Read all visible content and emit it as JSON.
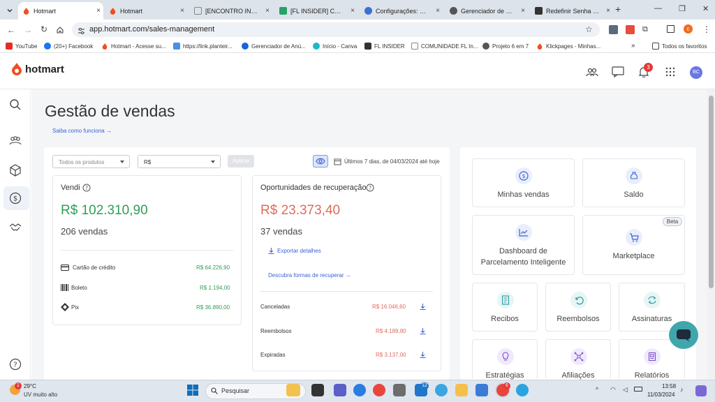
{
  "browser": {
    "tabs": [
      {
        "label": "Hotmart",
        "active": true
      },
      {
        "label": "Hotmart",
        "active": false
      },
      {
        "label": "[ENCONTRO INSIDER",
        "active": false
      },
      {
        "label": "[FL INSIDER] CENTRA",
        "active": false
      },
      {
        "label": "Configurações: Pree",
        "active": false
      },
      {
        "label": "Gerenciador de senh",
        "active": false
      },
      {
        "label": "Redefinir Senha ~ FL",
        "active": false
      }
    ],
    "new_tab_label": "+",
    "close_glyph": "×",
    "url": "app.hotmart.com/sales-management",
    "profile_initial": "c",
    "bookmarks": [
      {
        "label": "YouTube"
      },
      {
        "label": "(20+) Facebook"
      },
      {
        "label": "Hotmart - Acesse su..."
      },
      {
        "label": "https://link.planteir..."
      },
      {
        "label": "Gerenciador de Anú..."
      },
      {
        "label": "Início - Canva"
      },
      {
        "label": "FL INSIDER"
      },
      {
        "label": "COMUNIDADE FL In..."
      },
      {
        "label": "Projeto 6 em 7"
      },
      {
        "label": "Klickpages - Minhas..."
      }
    ],
    "bookmarks_overflow": "»",
    "all_bookmarks": "Todos os favoritos"
  },
  "app": {
    "brand": "hotmart",
    "notification_count": "3",
    "avatar_initials": "BC"
  },
  "page": {
    "title": "Gestão de vendas",
    "how_it_works": "Saiba como funciona →",
    "filters": {
      "products_placeholder": "Todos os produtos",
      "currency": "R$",
      "apply": "Aplicar",
      "date_range": "Últimos 7 dias, de 04/03/2024 até hoje"
    },
    "sold": {
      "title": "Vendi",
      "amount": "R$ 102.310,90",
      "count": "206 vendas",
      "methods": [
        {
          "label": "Cartão de crédito",
          "value": "R$ 64.226,90"
        },
        {
          "label": "Boleto",
          "value": "R$ 1.194,00"
        },
        {
          "label": "Pix",
          "value": "R$ 36.890,00"
        }
      ]
    },
    "recovery": {
      "title": "Oportunidades de recuperação",
      "amount": "R$ 23.373,40",
      "count": "37 vendas",
      "export": "Exportar detalhes",
      "discover": "Descubra formas de recuperar →",
      "items": [
        {
          "label": "Canceladas",
          "value": "R$ 16.046,60"
        },
        {
          "label": "Reembolsos",
          "value": "R$ 4.189,80"
        },
        {
          "label": "Expiradas",
          "value": "R$ 3.137,00"
        }
      ]
    },
    "shortcuts": {
      "my_sales": "Minhas vendas",
      "balance": "Saldo",
      "dashboard_line1": "Dashboard de",
      "dashboard_line2": "Parcelamento Inteligente",
      "marketplace": "Marketplace",
      "beta": "Beta",
      "receipts": "Recibos",
      "refunds": "Reembolsos",
      "subscriptions": "Assinaturas",
      "strategies": "Estratégias",
      "affiliations": "Afiliações",
      "reports": "Relatórios"
    }
  },
  "taskbar": {
    "weather_badge": "1",
    "temperature": "29°C",
    "weather_desc": "UV muito alto",
    "search": "Pesquisar",
    "mail_badge": "12",
    "chrome_badge": "6",
    "time": "13:58",
    "date": "11/03/2024"
  },
  "colors": {
    "accent_blue": "#3a62d6",
    "green_value": "#2e9e54",
    "red_value": "#e06b5a",
    "hotmart_orange": "#f04e23",
    "chat_teal": "#3fa7ac"
  }
}
